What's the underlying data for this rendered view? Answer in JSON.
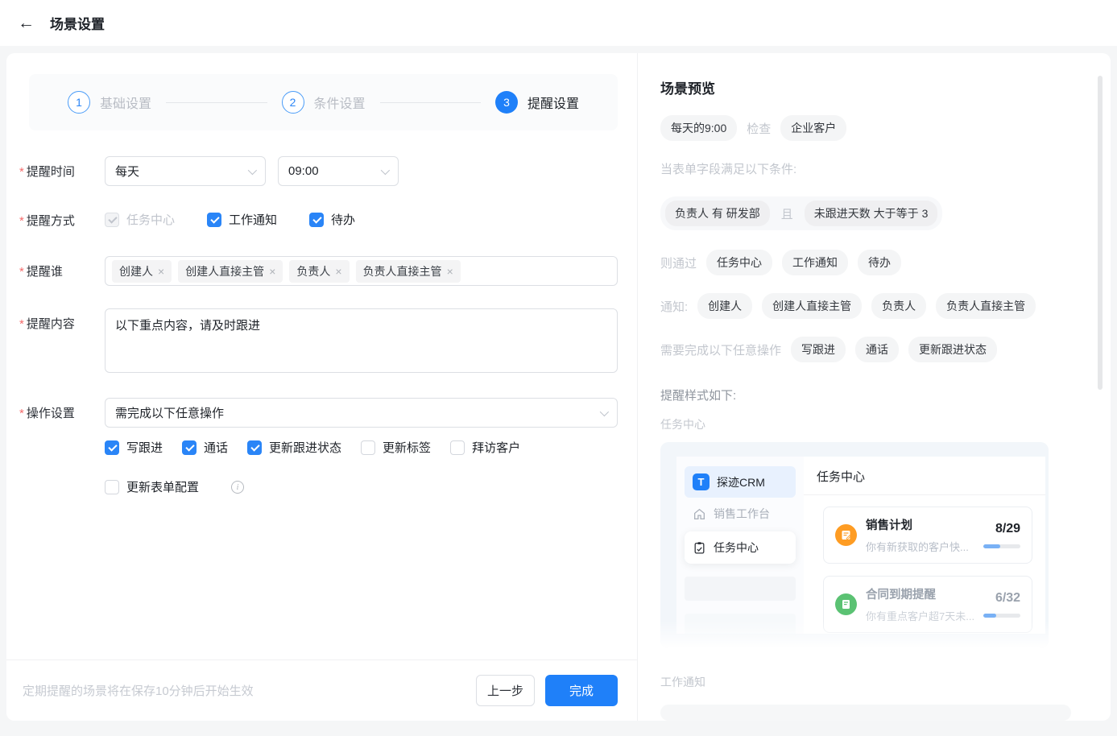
{
  "colors": {
    "primary_blue": "#1f80f9",
    "progress_blue": "#79b1f5",
    "task_orange": "#fe9c23",
    "task_green": "#5bc273",
    "required_red": "#f56c6c",
    "tag_gray_bg": "#f4f5f6"
  },
  "header": {
    "title": "场景设置",
    "back_icon": "arrow-left"
  },
  "steps": [
    {
      "num": "1",
      "label": "基础设置",
      "state": "todo"
    },
    {
      "num": "2",
      "label": "条件设置",
      "state": "todo"
    },
    {
      "num": "3",
      "label": "提醒设置",
      "state": "active"
    }
  ],
  "form": {
    "reminder_time": {
      "label": "提醒时间",
      "frequency_value": "每天",
      "time_value": "09:00"
    },
    "reminder_method": {
      "label": "提醒方式",
      "options": [
        {
          "label": "任务中心",
          "checked": true,
          "disabled": true
        },
        {
          "label": "工作通知",
          "checked": true,
          "disabled": false
        },
        {
          "label": "待办",
          "checked": true,
          "disabled": false
        }
      ]
    },
    "reminder_who": {
      "label": "提醒谁",
      "tags": [
        {
          "label": "创建人",
          "close": "×"
        },
        {
          "label": "创建人直接主管",
          "close": "×"
        },
        {
          "label": "负责人",
          "close": "×"
        },
        {
          "label": "负责人直接主管",
          "close": "×"
        }
      ]
    },
    "reminder_content": {
      "label": "提醒内容",
      "value": "以下重点内容，请及时跟进"
    },
    "action_setting": {
      "label": "操作设置",
      "select_value": "需完成以下任意操作",
      "options_row1": [
        {
          "label": "写跟进",
          "checked": true
        },
        {
          "label": "通话",
          "checked": true
        },
        {
          "label": "更新跟进状态",
          "checked": true
        },
        {
          "label": "更新标签",
          "checked": false
        },
        {
          "label": "拜访客户",
          "checked": false
        }
      ],
      "options_row2": [
        {
          "label": "更新表单配置",
          "checked": false,
          "info": "i"
        }
      ]
    }
  },
  "footer": {
    "note": "定期提醒的场景将在保存10分钟后开始生效",
    "prev_label": "上一步",
    "done_label": "完成"
  },
  "preview": {
    "title": "场景预览",
    "schedule": {
      "time_tag": "每天的9:00",
      "check_text": "检查",
      "target_tag": "企业客户"
    },
    "condition_intro": "当表单字段满足以下条件:",
    "conditions": {
      "c1": "负责人 有 研发部",
      "join": "且",
      "c2": "未跟进天数 大于等于 3"
    },
    "via": {
      "label": "则通过",
      "tags": [
        "任务中心",
        "工作通知",
        "待办"
      ]
    },
    "notify": {
      "label": "通知:",
      "tags": [
        "创建人",
        "创建人直接主管",
        "负责人",
        "负责人直接主管"
      ]
    },
    "actions": {
      "label": "需要完成以下任意操作",
      "tags": [
        "写跟进",
        "通话",
        "更新跟进状态"
      ]
    },
    "style_intro": "提醒样式如下:",
    "task_center_label": "任务中心",
    "mock": {
      "app_name": "探迹CRM",
      "logo_letter": "T",
      "nav": [
        {
          "label": "销售工作台",
          "active": false
        },
        {
          "label": "任务中心",
          "active": true
        }
      ],
      "panel_title": "任务中心",
      "tasks": [
        {
          "title": "销售计划",
          "count": "8/29",
          "desc": "你有新获取的客户快...",
          "progress": 45,
          "icon_color": "#fe9c23"
        },
        {
          "title": "合同到期提醒",
          "count": "6/32",
          "desc": "你有重点客户超7天未...",
          "progress": 35,
          "icon_color": "#5bc273"
        }
      ]
    },
    "work_notice_label": "工作通知"
  }
}
